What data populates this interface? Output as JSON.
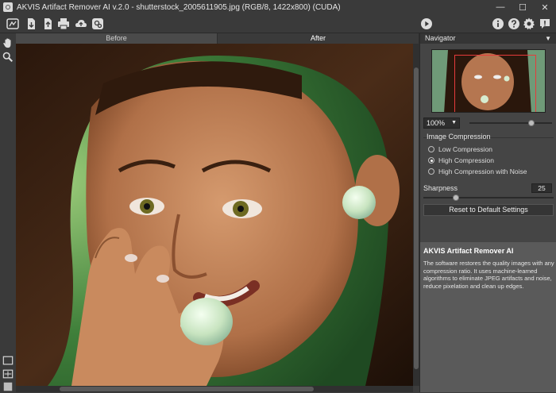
{
  "window": {
    "title": "AKVIS Artifact Remover AI v.2.0 - shutterstock_2005611905.jpg (RGB/8, 1422x800) (CUDA)",
    "minimize": "—",
    "maximize": "☐",
    "close": "✕"
  },
  "toolbar": {
    "icons": [
      "workspace-icon",
      "open-icon",
      "save-icon",
      "print-icon",
      "share-icon",
      "batch-icon",
      "run-icon",
      "info-icon",
      "help-icon",
      "settings-icon",
      "notify-icon"
    ]
  },
  "view_tabs": {
    "before": "Before",
    "after": "After"
  },
  "navigator": {
    "title": "Navigator",
    "zoom": "100%",
    "zoom_level": 0.75
  },
  "compression": {
    "title": "Image Compression",
    "options": [
      "Low Compression",
      "High Compression",
      "High Compression with Noise"
    ],
    "selected": "High Compression"
  },
  "sharpness": {
    "label": "Sharpness",
    "value": "25",
    "level": 0.25
  },
  "reset_label": "Reset to Default Settings",
  "info": {
    "title": "AKVIS Artifact Remover AI",
    "text": "The software restores the quality images with any compression ratio. It uses machine-learned algorithms to eliminate JPEG artifacts and noise, reduce pixelation and clean up edges."
  },
  "colors": {
    "accent_frame": "#e63b3b",
    "panel": "#454545",
    "info_bg": "#5a5a5a"
  }
}
